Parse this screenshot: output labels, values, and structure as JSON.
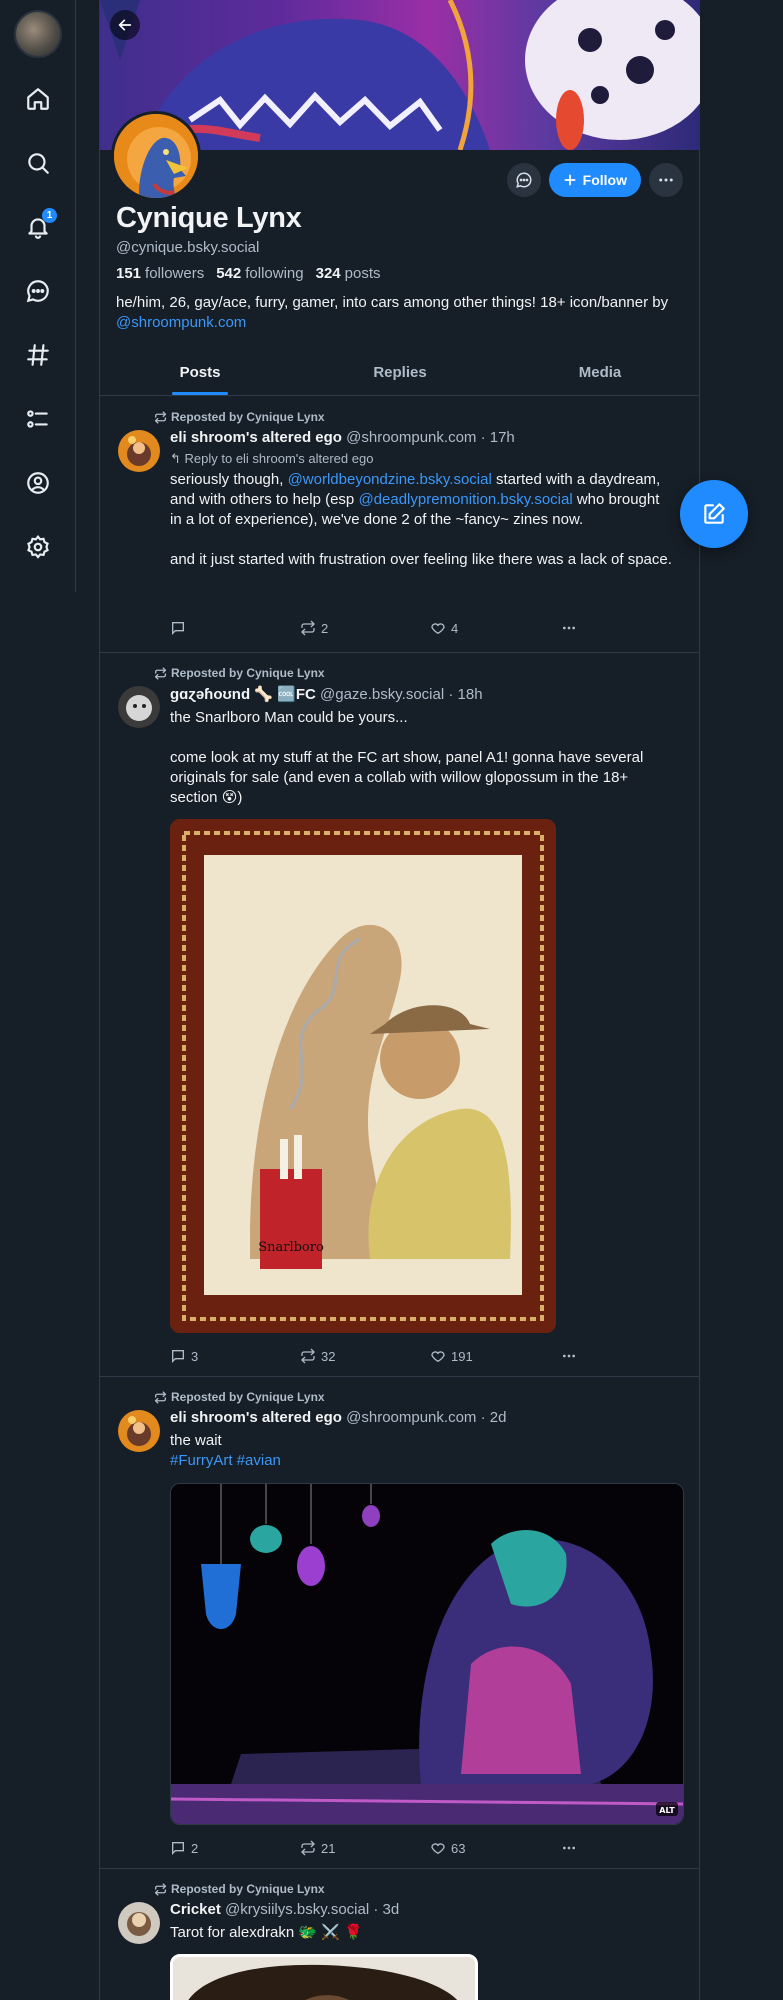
{
  "sidebar": {
    "badge_count": "1"
  },
  "profile": {
    "display_name": "Cynique Lynx",
    "handle": "@cynique.bsky.social",
    "followers_count": "151",
    "followers_label": "followers",
    "following_count": "542",
    "following_label": "following",
    "posts_count": "324",
    "posts_label": "posts",
    "bio_text": "he/him, 26, gay/ace, furry, gamer, into cars among other things! 18+ icon/banner by ",
    "bio_link": "@shroompunk.com",
    "follow_label": "Follow"
  },
  "tabs": [
    "Posts",
    "Replies",
    "Media"
  ],
  "posts": [
    {
      "repost_label": "Reposted by Cynique Lynx",
      "author": "eli shroom's altered ego",
      "handle": "@shroompunk.com",
      "time": "· 17h",
      "reply_to": "Reply to eli shroom's altered ego",
      "text_1": "seriously though, ",
      "mention_1": "@worldbeyondzine.bsky.social",
      "text_2": " started with a daydream, and with others to help (esp  ",
      "mention_2": "@deadlypremonition.bsky.social",
      "text_3": " who brought in a lot of experience), we've done 2 of the ~fancy~ zines now.",
      "text_4": "and it just started with frustration over feeling like there was a lack of space.",
      "replies": "",
      "reposts": "2",
      "likes": "4"
    },
    {
      "repost_label": "Reposted by Cynique Lynx",
      "author": "ɡɑɀǝɦoʊnd 🦴 🆒FC",
      "handle": "@gaze.bsky.social",
      "time": "· 18h",
      "text_1": "the Snarlboro Man could be yours...",
      "text_2": "come look at my stuff at the FC art show, panel A1! gonna have several originals for sale (and even a collab with willow glopossum in the 18+ section 😵)",
      "image_caption": "Snarlboro",
      "replies": "3",
      "reposts": "32",
      "likes": "191"
    },
    {
      "repost_label": "Reposted by Cynique Lynx",
      "author": "eli shroom's altered ego",
      "handle": "@shroompunk.com",
      "time": "· 2d",
      "text_1": "the wait",
      "tags": "#FurryArt #avian",
      "alt_badge": "ALT",
      "replies": "2",
      "reposts": "21",
      "likes": "63"
    },
    {
      "repost_label": "Reposted by Cynique Lynx",
      "author": "Cricket",
      "handle": "@krysiilys.bsky.social",
      "time": "· 3d",
      "text_1": "Tarot for alexdrakn 🐲 ⚔️ 🌹"
    }
  ],
  "colors": {
    "accent": "#208bfe",
    "background": "#161e27",
    "muted": "#aebbc9"
  }
}
